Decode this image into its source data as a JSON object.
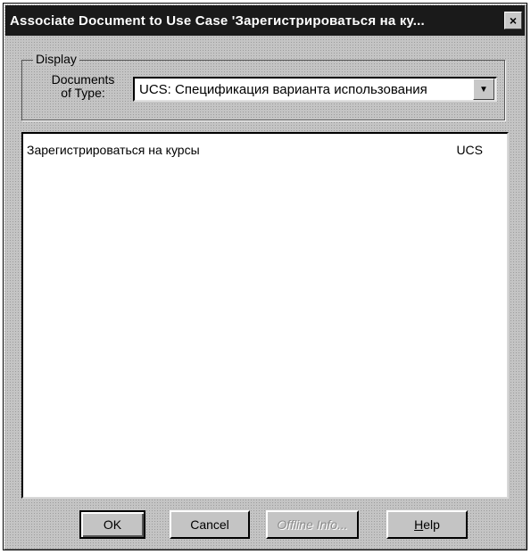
{
  "window": {
    "title": "Associate Document to Use Case 'Зарегистрироваться на ку...",
    "close_symbol": "×"
  },
  "display_group": {
    "legend": "Display",
    "documents_label_line1": "Documents",
    "documents_label_line2": "of Type:",
    "document_type_value": "UCS: Спецификация варианта использования",
    "dropdown_arrow": "▼"
  },
  "documents_list": [
    {
      "name": "Зарегистрироваться на курсы",
      "type": "UCS"
    }
  ],
  "buttons": {
    "ok": "OK",
    "cancel": "Cancel",
    "offline_info": "Offline Info...",
    "help_mnemonic": "H",
    "help_rest": "elp"
  }
}
